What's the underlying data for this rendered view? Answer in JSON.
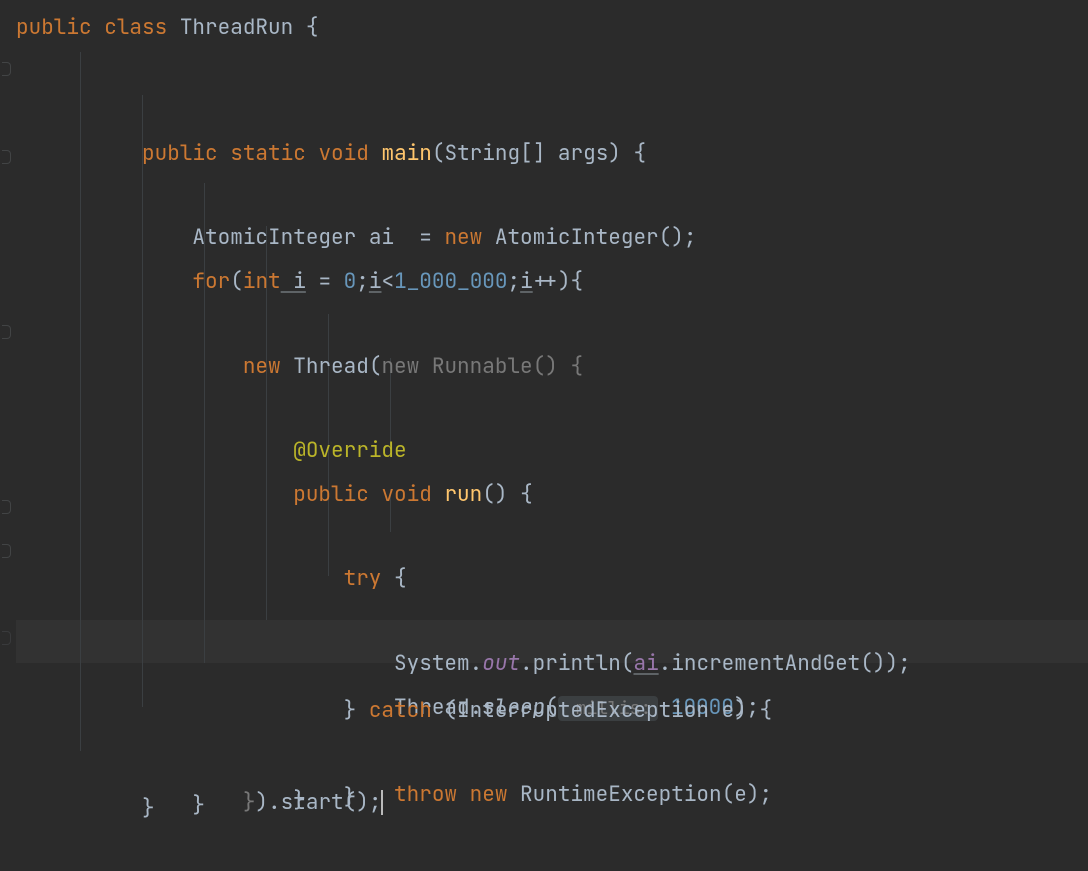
{
  "code": {
    "class_decl": {
      "public": "public",
      "class": "class",
      "name": "ThreadRun",
      "obrace": " {"
    },
    "main_decl": {
      "public": "public",
      "static": "static",
      "void": "void",
      "name": "main",
      "lparen": "(",
      "type": "String",
      "brackets": "[]",
      "arg": " args",
      "rparen": ")",
      "obrace": " {"
    },
    "ai_decl": {
      "type": "AtomicInteger",
      "var": " ai  ",
      "eq": "= ",
      "new": "new",
      "ctor": " AtomicInteger",
      "parens": "()",
      "semi": ";"
    },
    "for_decl": {
      "for": "for",
      "lparen": "(",
      "int": "int",
      "i": " i",
      "eq": " = ",
      "zero": "0",
      "semi1": ";",
      "cond_i": "i",
      "lt": "<",
      "million": "1_000_000",
      "semi2": ";",
      "inc_i": "i",
      "plusplus": "++",
      "rparen": ")",
      "obrace": "{"
    },
    "thread_new": {
      "new": "new",
      "thread": " Thread",
      "lparen": "(",
      "new2": "new",
      "runnable": " Runnable",
      "parens": "()",
      "obrace": " {"
    },
    "override": "@Override",
    "run_decl": {
      "public": "public",
      "void": "void",
      "name": "run",
      "parens": "()",
      "obrace": " {"
    },
    "try_decl": {
      "try": "try",
      "obrace": " {"
    },
    "println_line": {
      "system": "System",
      "dot1": ".",
      "out": "out",
      "dot2": ".",
      "println": "println",
      "lparen": "(",
      "ai": "ai",
      "dot3": ".",
      "incget": "incrementAndGet",
      "parens": "()",
      "rparen": ")",
      "semi": ";"
    },
    "sleep_line": {
      "thread": "Thread",
      "dot": ".",
      "sleep": "sleep",
      "lparen": "(",
      "hint": " millis:",
      "sp": " ",
      "val": "10000",
      "rparen": ")",
      "semi": ";"
    },
    "catch_line": {
      "cbrace": "}",
      "catch": " catch ",
      "lparen": "(",
      "exc": "InterruptedException",
      "e": " e",
      "rparen": ")",
      "obrace": " {"
    },
    "throw_line": {
      "throw": "throw",
      "sp": " ",
      "new": "new",
      "rte": " RuntimeException",
      "lparen": "(",
      "e": "e",
      "rparen": ")",
      "semi": ";"
    },
    "close_try": "}",
    "close_run": "}",
    "close_anon": {
      "cbrace": "}",
      "rparen": ")",
      "dot": ".",
      "start": "start",
      "parens": "()",
      "semi": ";"
    },
    "close_for": "}",
    "close_main": "}",
    "close_class_partial": "ˬ"
  },
  "indent": {
    "i1": "    ",
    "i2": "        ",
    "i3": "            ",
    "i4": "                ",
    "i5": "                    ",
    "i6": "                        ",
    "i7": "                            "
  }
}
